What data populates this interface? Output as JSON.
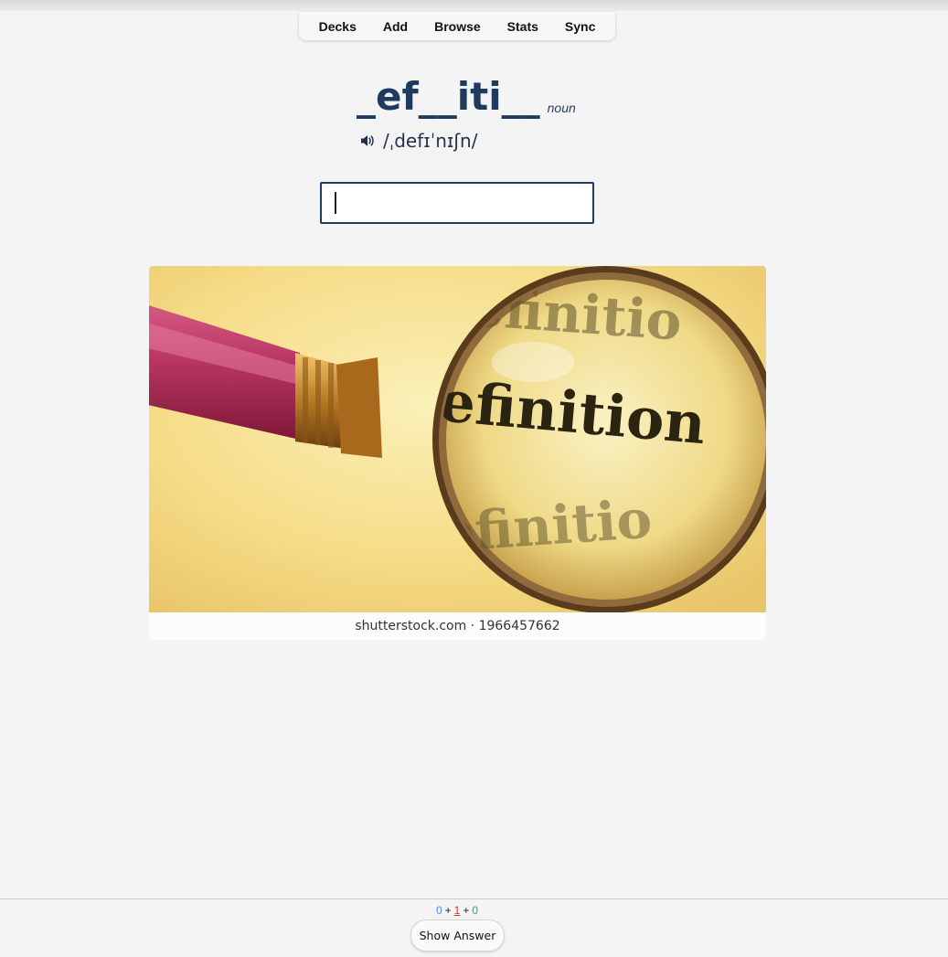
{
  "nav": {
    "items": [
      "Decks",
      "Add",
      "Browse",
      "Stats",
      "Sync"
    ]
  },
  "card": {
    "term": "_ef__iti__",
    "part_of_speech": "noun",
    "pronunciation": "/ˌdefɪˈnɪʃn/",
    "speaker_icon": "speaker-icon",
    "answer_value": "",
    "image": {
      "lens_word": "definition",
      "credit": "shutterstock.com · 1966457662"
    }
  },
  "bottom": {
    "counts": {
      "new": "0",
      "learning": "1",
      "review": "0",
      "separator": "+"
    },
    "show_answer_label": "Show Answer"
  },
  "colors": {
    "title": "#1e3a5f",
    "input_border": "#1f3b67",
    "new": "#4a90d9",
    "learning": "#c0392b",
    "review": "#27ae60"
  }
}
